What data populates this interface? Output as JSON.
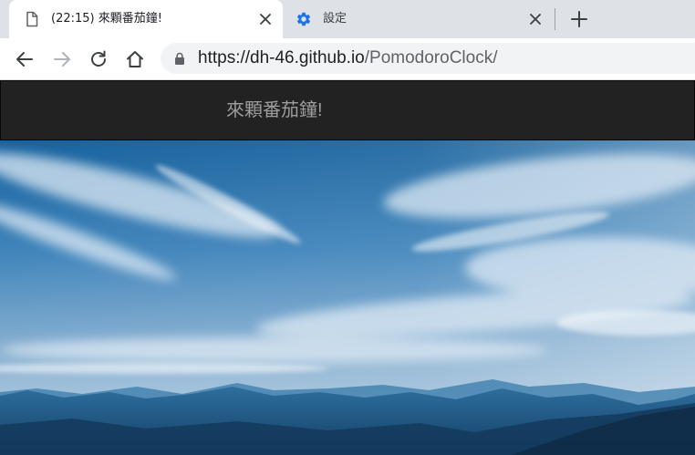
{
  "browser": {
    "tabs": [
      {
        "title": "(22:15) 來顆番茄鐘!",
        "icon": "document-icon",
        "active": true
      },
      {
        "title": "設定",
        "icon": "gear-icon",
        "active": false
      }
    ],
    "address": {
      "scheme_host": "https://dh-46.github.io",
      "path": "/PomodoroClock/"
    }
  },
  "page": {
    "navbar": {
      "brand": "來顆番茄鐘!"
    },
    "hero": {
      "image": "mountain-sky-landscape"
    }
  },
  "colors": {
    "tabstrip": "#dee1e6",
    "navbar": "#222222",
    "brand_text": "#9d9d9d",
    "settings_icon": "#1a73e8"
  }
}
